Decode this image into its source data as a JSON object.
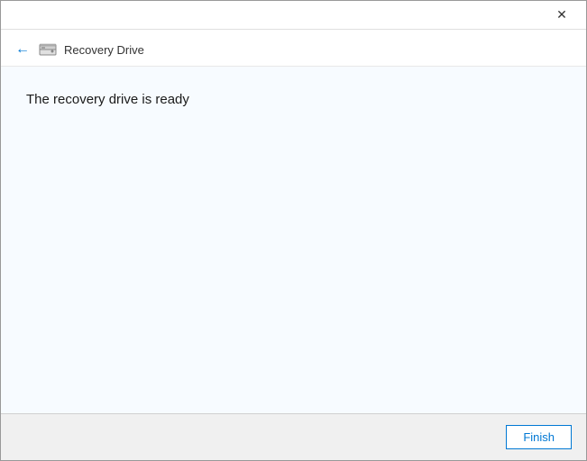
{
  "window": {
    "title": "Recovery Drive"
  },
  "header": {
    "title": "Recovery Drive"
  },
  "content": {
    "message": "The recovery drive is ready"
  },
  "footer": {
    "finish_button_label": "Finish"
  },
  "icons": {
    "close": "✕",
    "back_arrow": "←"
  }
}
